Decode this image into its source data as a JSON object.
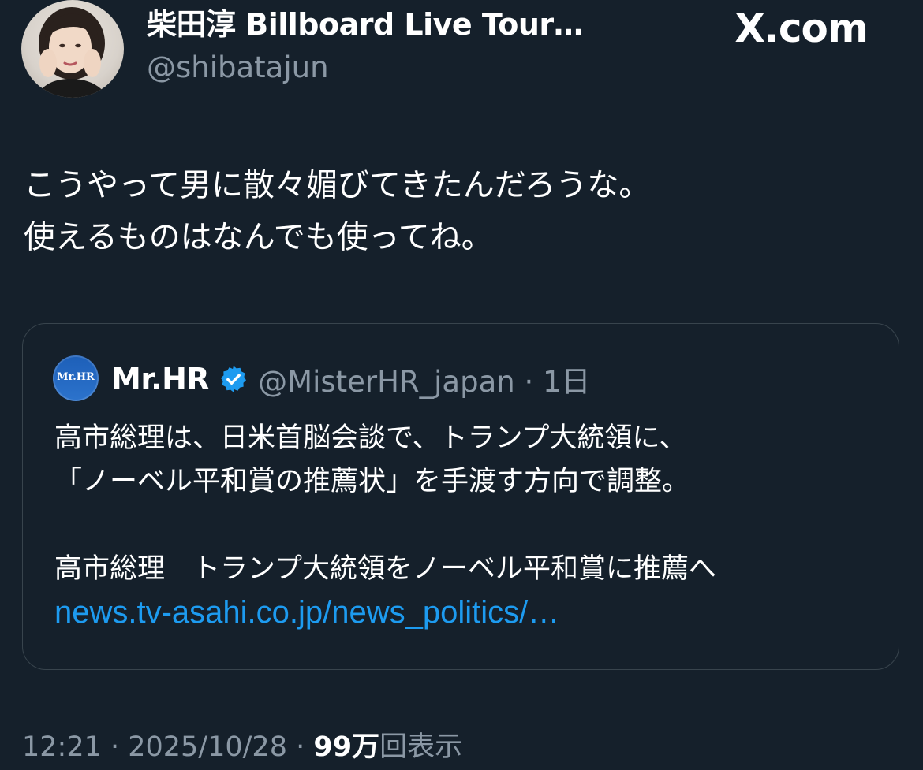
{
  "author": {
    "display_name": "柴田淳 Billboard Live Tour…",
    "handle": "@shibatajun"
  },
  "brand": "X.com",
  "tweet": {
    "lines": [
      "こうやって男に散々媚びてきたんだろうな。",
      "使えるものはなんでも使ってね。"
    ]
  },
  "quote": {
    "avatar_text": "Mr.HR",
    "name": "Mr.HR",
    "meta": "@MisterHR_japan · 1日",
    "lines": [
      "高市総理は、日米首脳会談で、トランプ大統領に、",
      "「ノーベル平和賞の推薦状」を手渡す方向で調整。"
    ],
    "headline": "高市総理　トランプ大統領をノーベル平和賞に推薦へ",
    "link": "news.tv-asahi.co.jp/news_politics/…"
  },
  "footer": {
    "time_date": "12:21 · 2025/10/28 · ",
    "views_count": "99万",
    "views_label": "回表示"
  },
  "colors": {
    "background": "#15202b",
    "secondary_text": "#8b98a5",
    "link": "#1d9bf0",
    "verified_badge": "#1d9bf0",
    "card_border": "#38444d"
  }
}
